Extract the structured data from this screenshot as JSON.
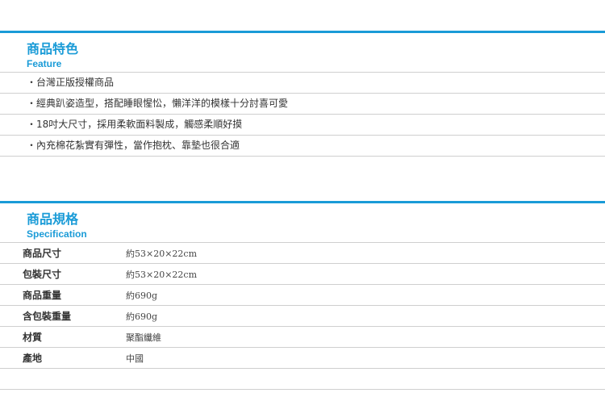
{
  "feature": {
    "title_zh": "商品特色",
    "title_en": "Feature",
    "items": [
      "・台灣正版授權商品",
      "・經典趴姿造型，搭配睡眼惺忪，懶洋洋的模樣十分討喜可愛",
      "・18吋大尺寸，採用柔軟面料製成，觸感柔順好摸",
      "・內充棉花紮實有彈性，當作抱枕、靠墊也很合適"
    ]
  },
  "specification": {
    "title_zh": "商品規格",
    "title_en": "Specification",
    "rows": [
      {
        "label": "商品尺寸",
        "value": "約53×20×22cm"
      },
      {
        "label": "包裝尺寸",
        "value": "約53×20×22cm"
      },
      {
        "label": "商品重量",
        "value": "約690g"
      },
      {
        "label": "含包裝重量",
        "value": "約690g"
      },
      {
        "label": "材質",
        "value": "聚酯纖維"
      },
      {
        "label": "產地",
        "value": "中國"
      }
    ]
  },
  "colors": {
    "accent": "#1a9bd7",
    "rule": "#cfcfcf"
  }
}
